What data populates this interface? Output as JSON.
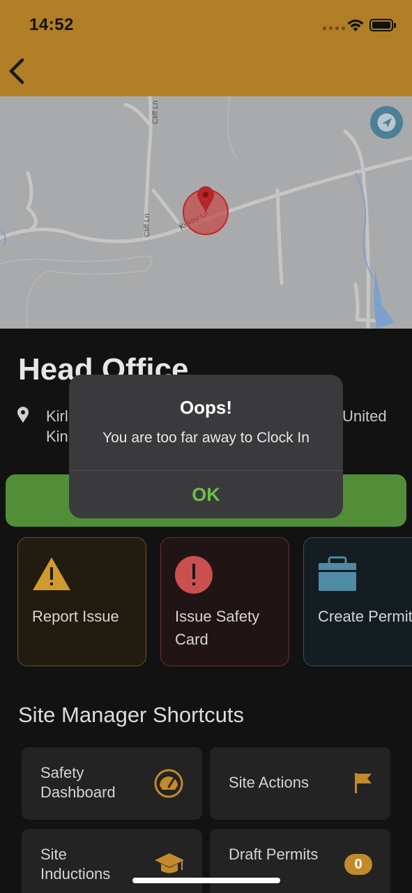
{
  "status_bar": {
    "time": "14:52"
  },
  "map": {
    "roads": [
      "Cliff Ln",
      "Cliff Ln",
      "Kirkby Ln"
    ]
  },
  "site": {
    "title": "Head Office",
    "address_line1": "Kirl",
    "address_line1_end": "United",
    "address_line2": "Kin"
  },
  "cards": {
    "report_issue": "Report Issue",
    "issue_safety_card": "Issue Safety Card",
    "create_permit": "Create Permit"
  },
  "shortcuts": {
    "title": "Site Manager Shortcuts",
    "safety_dashboard": "Safety Dashboard",
    "site_actions": "Site Actions",
    "site_inductions": "Site Inductions",
    "draft_permits": "Draft Permits",
    "draft_permits_count": "0"
  },
  "dialog": {
    "title": "Oops!",
    "message": "You are too far away to Clock In",
    "ok_label": "OK"
  },
  "colors": {
    "accent": "#b07e25",
    "clock_in_green": "#528e38",
    "ok_green": "#6cbf4a",
    "danger": "#c9504f",
    "permit_blue": "#4f8aa6"
  }
}
